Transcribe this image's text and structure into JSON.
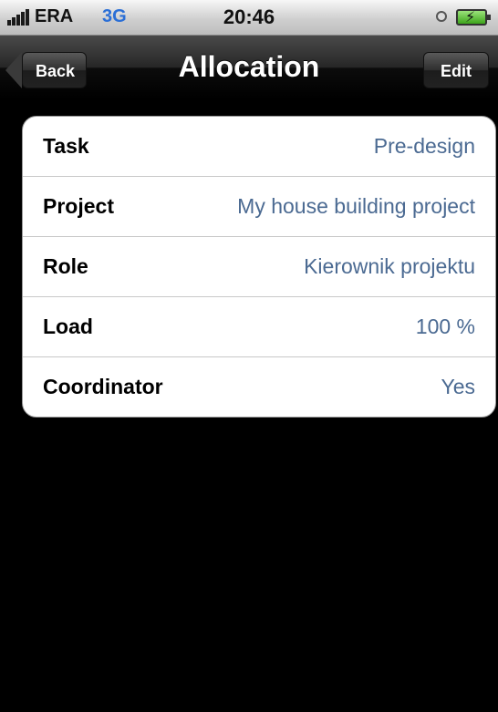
{
  "status_bar": {
    "carrier": "ERA",
    "network": "3G",
    "time": "20:46",
    "icons": {
      "alarm": "alarm-icon",
      "battery": "battery-charging-icon"
    }
  },
  "nav_bar": {
    "title": "Allocation",
    "back_label": "Back",
    "edit_label": "Edit"
  },
  "rows": [
    {
      "label": "Task",
      "value": "Pre-design"
    },
    {
      "label": "Project",
      "value": "My house building project"
    },
    {
      "label": "Role",
      "value": "Kierownik projektu"
    },
    {
      "label": "Load",
      "value": "100 %"
    },
    {
      "label": "Coordinator",
      "value": "Yes"
    }
  ],
  "colors": {
    "value_text": "#4b6a92",
    "background": "#000000",
    "network": "#2b6fd6"
  }
}
